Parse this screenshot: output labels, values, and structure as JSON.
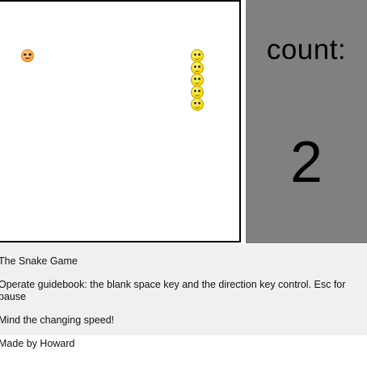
{
  "game": {
    "score_label": "count:",
    "score": "2",
    "food": {
      "icon": "orange-face-food-icon",
      "color": "#f7b25a"
    },
    "snake": {
      "icon": "yellow-face-segment-icon",
      "color": "#f6e11c",
      "length": 5,
      "direction": "vertical"
    }
  },
  "info": {
    "title": "The Snake Game",
    "guide": "Operate guidebook: the blank space key and the direction key control. Esc for pause",
    "tip": "Mind the changing speed!"
  },
  "footer": {
    "credit": "Made by Howard"
  },
  "colors": {
    "board_bg": "#ffffff",
    "board_border": "#000000",
    "score_panel_bg": "#808080",
    "info_bg": "#f0f0f0"
  }
}
